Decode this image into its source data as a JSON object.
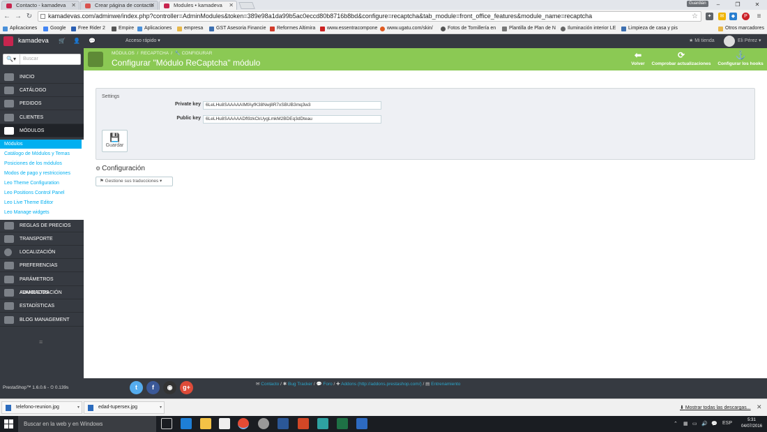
{
  "browser": {
    "tabs": [
      {
        "label": "Contacto - kamadeva",
        "active": false
      },
      {
        "label": "Crear página de contacto",
        "active": false
      },
      {
        "label": "Modules • kamadeva",
        "active": true
      }
    ],
    "window_user": "Guardián",
    "url": "kamadevas.com/adminwe/index.php?controller=AdminModules&token=389e98a1da99b5ac0eccd80b8716b8bd&configure=recaptcha&tab_module=front_office_features&module_name=recaptcha",
    "bookmarks": [
      {
        "label": "Aplicaciones",
        "icon_color": "#4a90d9"
      },
      {
        "label": "Google",
        "icon_color": "#4285f4"
      },
      {
        "label": "Free Rider 2",
        "icon_color": "#2b5fb3"
      },
      {
        "label": "Empire",
        "icon_color": "#555555"
      },
      {
        "label": "Aplicaciones",
        "icon_color": "#4a90d9"
      },
      {
        "label": "empresa",
        "icon_color": "#e8b84a"
      },
      {
        "label": "GST Asesoria Financie",
        "icon_color": "#3c6fb0"
      },
      {
        "label": "Reformes Altimira",
        "icon_color": "#d23b2a"
      },
      {
        "label": "www.essentracompone",
        "icon_color": "#cc2222"
      },
      {
        "label": "www.ugatu.com/skin/",
        "icon_color": "#e05a20"
      },
      {
        "label": "Fotos de Tornillería en",
        "icon_color": "#555555"
      },
      {
        "label": "Plantilla de Plan de N",
        "icon_color": "#777777"
      },
      {
        "label": "Iluminación interior LE",
        "icon_color": "#666666"
      },
      {
        "label": "Limpieza de casa y pis",
        "icon_color": "#3c6fb0"
      }
    ],
    "other_bookmarks": "Otros marcadores"
  },
  "header": {
    "shop_name": "kamadeva",
    "quick_access": "Acceso rápido",
    "my_store": "Mi tienda",
    "user": "Eli Pérez"
  },
  "sidebar": {
    "search_placeholder": "Buscar",
    "items": [
      {
        "label": "INICIO"
      },
      {
        "label": "CATÁLOGO"
      },
      {
        "label": "PEDIDOS"
      },
      {
        "label": "CLIENTES"
      },
      {
        "label": "MÓDULOS"
      },
      {
        "label": "REGLAS DE PRECIOS"
      },
      {
        "label": "TRANSPORTE"
      },
      {
        "label": "LOCALIZACIÓN"
      },
      {
        "label": "PREFERENCIAS"
      },
      {
        "label": "PARÁMETROS AVANZADOS"
      },
      {
        "label": "ADMINISTRACIÓN"
      },
      {
        "label": "ESTADÍSTICAS"
      },
      {
        "label": "BLOG MANAGEMENT"
      }
    ],
    "submenu": [
      {
        "label": "Módulos",
        "active": true
      },
      {
        "label": "Catálogo de Módulos y Temas"
      },
      {
        "label": "Posiciones de los módulos"
      },
      {
        "label": "Modos de pago y restricciones"
      },
      {
        "label": "Leo Theme Configuration"
      },
      {
        "label": "Leo Positions Control Panel"
      },
      {
        "label": "Leo Live Theme Editor"
      },
      {
        "label": "Leo Manage widgets"
      }
    ]
  },
  "toolbar": {
    "breadcrumb": [
      "MÓDULOS",
      "RECAPTCHA",
      "CONFIGURAR"
    ],
    "title": "Configurar \"Módulo ReCaptcha\" módulo",
    "buttons": [
      {
        "label": "Volver",
        "icon": "back-icon"
      },
      {
        "label": "Comprobar actualizaciones",
        "icon": "refresh-icon"
      },
      {
        "label": "Configurar los hooks",
        "icon": "anchor-icon"
      }
    ]
  },
  "settings": {
    "heading": "Settings",
    "private_key_label": "Private key",
    "private_key_value": "6LeLHu8SAAAAAIMfAyfK38Nwj8R7xSBUB3mq3w3",
    "public_key_label": "Public key",
    "public_key_value": "6LeLHu8SAAAAADfl9zkCkUygLmkM2BDEq3dDteau",
    "save_label": "Guardar"
  },
  "configuration": {
    "title": "Configuración",
    "translations_button": "Gestione sus traducciones"
  },
  "footer": {
    "version": "PrestaShop™ 1.6.0.6",
    "load_time": "0.139s",
    "links": [
      "Contacto",
      "Bug Tracker",
      "Foro",
      "Addons (http://addons.prestashop.com/)",
      "Entrenamiento"
    ]
  },
  "downloads": {
    "files": [
      "telefono-reunion.jpg",
      "edad-tupersex.jpg"
    ],
    "show_all": "Mostrar todas las descargas..."
  },
  "taskbar": {
    "search_placeholder": "Buscar en la web y en Windows",
    "language": "ESP",
    "time": "5:31",
    "date": "04/07/2016"
  },
  "colors": {
    "toolbar_green": "#8bc954",
    "sidebar_dark": "#363a41",
    "link_blue": "#00aff0"
  }
}
